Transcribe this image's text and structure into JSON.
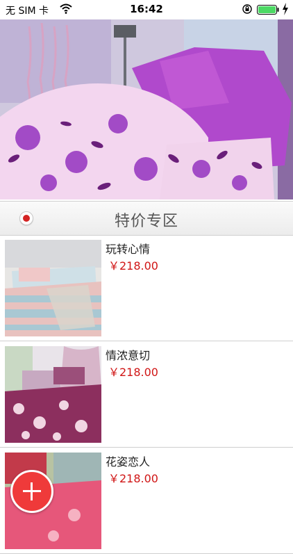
{
  "status_bar": {
    "carrier": "无 SIM 卡",
    "time": "16:42",
    "icons": [
      "wifi-icon",
      "orientation-lock-icon",
      "battery-icon",
      "charging-bolt-icon"
    ]
  },
  "banner": {
    "image": "bedding-banner-image",
    "colors": {
      "bedding": "#f3d6ef",
      "flower": "#a24bc6",
      "leaf": "#6a1f7a",
      "accent": "#9b30c8"
    }
  },
  "section": {
    "title": "特价专区",
    "indicator_color": "#d42323"
  },
  "products": [
    {
      "name": "玩转心情",
      "price": "￥218.00",
      "image": "bedding-product-image-1"
    },
    {
      "name": "情浓意切",
      "price": "￥218.00",
      "image": "bedding-product-image-2"
    },
    {
      "name": "花姿恋人",
      "price": "￥218.00",
      "image": "bedding-product-image-3"
    }
  ],
  "fab": {
    "icon": "plus-icon",
    "color": "#ef3a3a"
  }
}
